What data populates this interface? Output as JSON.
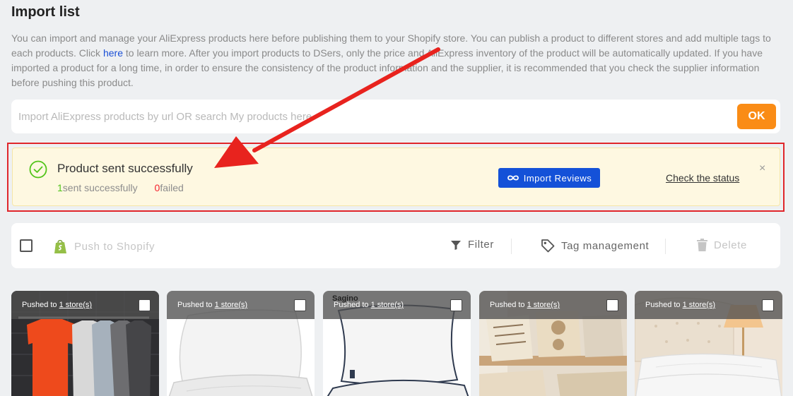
{
  "page": {
    "title": "Import list",
    "description": {
      "text_before": "You can import and manage your AliExpress products here before publishing them to your Shopify store. You can publish a product to different stores and add multiple tags to each products. Click ",
      "link": "here",
      "text_after": " to learn more. After you import products to DSers, only the price and AliExpress inventory of the product will be automatically updated. If you have imported a product for a long time, in order to ensure the consistency of the product information and the supplier, it is recommended that you check the supplier information before pushing this product."
    }
  },
  "search": {
    "placeholder": "Import AliExpress products by url OR search My products here",
    "value": "",
    "button_label": "OK"
  },
  "alert": {
    "title": "Product sent successfully",
    "success_count": "1",
    "success_label": "sent successfully",
    "failed_count": "0",
    "failed_label": "failed",
    "import_reviews_label": "Import Reviews",
    "check_status_label": "Check the status",
    "close_glyph": "×"
  },
  "toolbar": {
    "push_label": "Push to Shopify",
    "filter_label": "Filter",
    "tag_label": "Tag management",
    "delete_label": "Delete"
  },
  "products": [
    {
      "pushed_text": "Pushed to",
      "stores_link": "1 store(s)",
      "image": "orange-tshirts-on-rack"
    },
    {
      "pushed_text": "Pushed to",
      "stores_link": "1 store(s)",
      "image": "white-pillows"
    },
    {
      "pushed_text": "Pushed to",
      "stores_link": "1 store(s)",
      "image": "white-pillows-piped",
      "brand": "Sagino"
    },
    {
      "pushed_text": "Pushed to",
      "stores_link": "1 store(s)",
      "image": "decorative-cushions-bench"
    },
    {
      "pushed_text": "Pushed to",
      "stores_link": "1 store(s)",
      "image": "pillows-on-bed"
    }
  ],
  "colors": {
    "accent_orange": "#fa8c16",
    "primary_blue": "#1451d8",
    "success_green": "#52c41a",
    "error_red": "#f5222d",
    "annotation_red": "#e0262b"
  }
}
